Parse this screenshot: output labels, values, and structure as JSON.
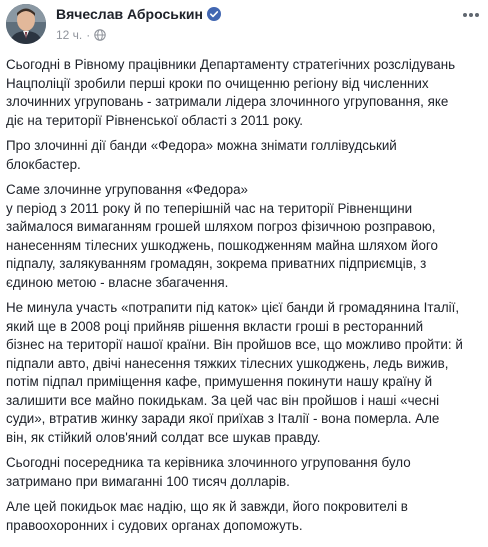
{
  "post": {
    "author": "Вячеслав Аброськин",
    "time": "12 ч.",
    "dot": "·",
    "paragraphs": [
      "Сьогодні в Рівному працівники Департаменту стратегічних розслідувань\nНацполіції зробили перші кроки по очищенню регіону від численних\nзлочинних угруповань - затримали лідера злочинного угруповання, яке\nдіє на території Рівненської області з 2011 року.",
      "Про злочинні дії банди «Федора» можна знімати голлівудський\nблокбастер.",
      "Саме злочинне угруповання «Федора»\nу період з 2011 року й по теперішній час на території Рівненщини\nзаймалося вимаганням грошей шляхом погроз фізичною розправою,\nнанесенням тілесних ушкоджень, пошкодженням майна шляхом його\nпідпалу, залякуванням громадян, зокрема приватних підприємців, з\nєдиною метою - власне збагачення.",
      "Не минула участь «потрапити під каток» цієї банди й громадянина Італії,\nякий ще в 2008 році прийняв рішення вкласти гроші в ресторанний\nбізнес на території нашої країни. Він пройшов все, що можливо пройти: й\nпідпали авто, двічі нанесення тяжких тілесних ушкоджень, ледь вижив,\nпотім підпал приміщення кафе, примушення покинути нашу країну й\nзалишити все майно покидькам. За цей час він пройшов і наші «чесні\nсуди», втратив жинку заради якої приїхав з Італії - вона померла. Але\nвін, як стійкий олов'яний солдат все шукав правду.",
      "Сьогодні посередника та керівника злочинного угруповання було\nзатримано при вимаганні 100 тисяч долларів.",
      "Але цей покидьок має надію, що як й завжди, його покровителі в\nправоохоронних і судових органах допоможуть."
    ]
  },
  "icons": {
    "verified": "verified-badge-icon",
    "audience": "globe-icon",
    "more": "more-options-icon"
  },
  "colors": {
    "text": "#1d2129",
    "meta": "#90949c",
    "verified": "#4267b2"
  }
}
